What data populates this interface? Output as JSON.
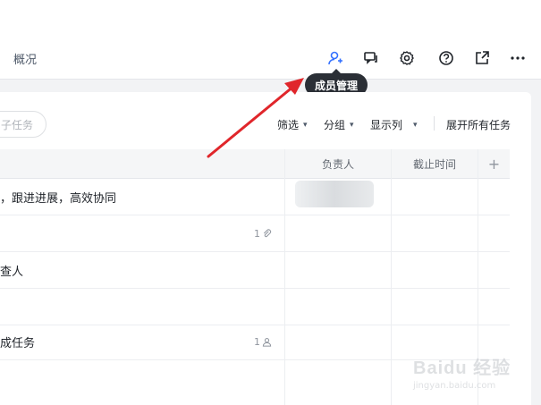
{
  "header": {
    "tab_overview": "概况",
    "tooltip": "成员管理",
    "icons": [
      "member-manage-icon",
      "comment-icon",
      "gear-icon",
      "help-icon",
      "open-external-icon",
      "more-icon"
    ]
  },
  "toolbar": {
    "subtask_label": "子任务",
    "filter_label": "筛选",
    "group_label": "分组",
    "display_columns_label": "显示列",
    "expand_all_label": "展开所有任务"
  },
  "table": {
    "columns": [
      "负责人",
      "截止时间"
    ],
    "rows": [
      {
        "text": "，跟进进展，高效协同",
        "meta": ""
      },
      {
        "text": "",
        "meta": "1"
      },
      {
        "text": "查人",
        "meta": ""
      },
      {
        "text": "",
        "meta": ""
      },
      {
        "text": "成任务",
        "meta": "1"
      }
    ]
  },
  "watermark": {
    "title": "Baidu 经验",
    "subtitle": "jingyan.baidu.com"
  },
  "colors": {
    "accent": "#3370ff",
    "arrow": "#e0262b"
  }
}
